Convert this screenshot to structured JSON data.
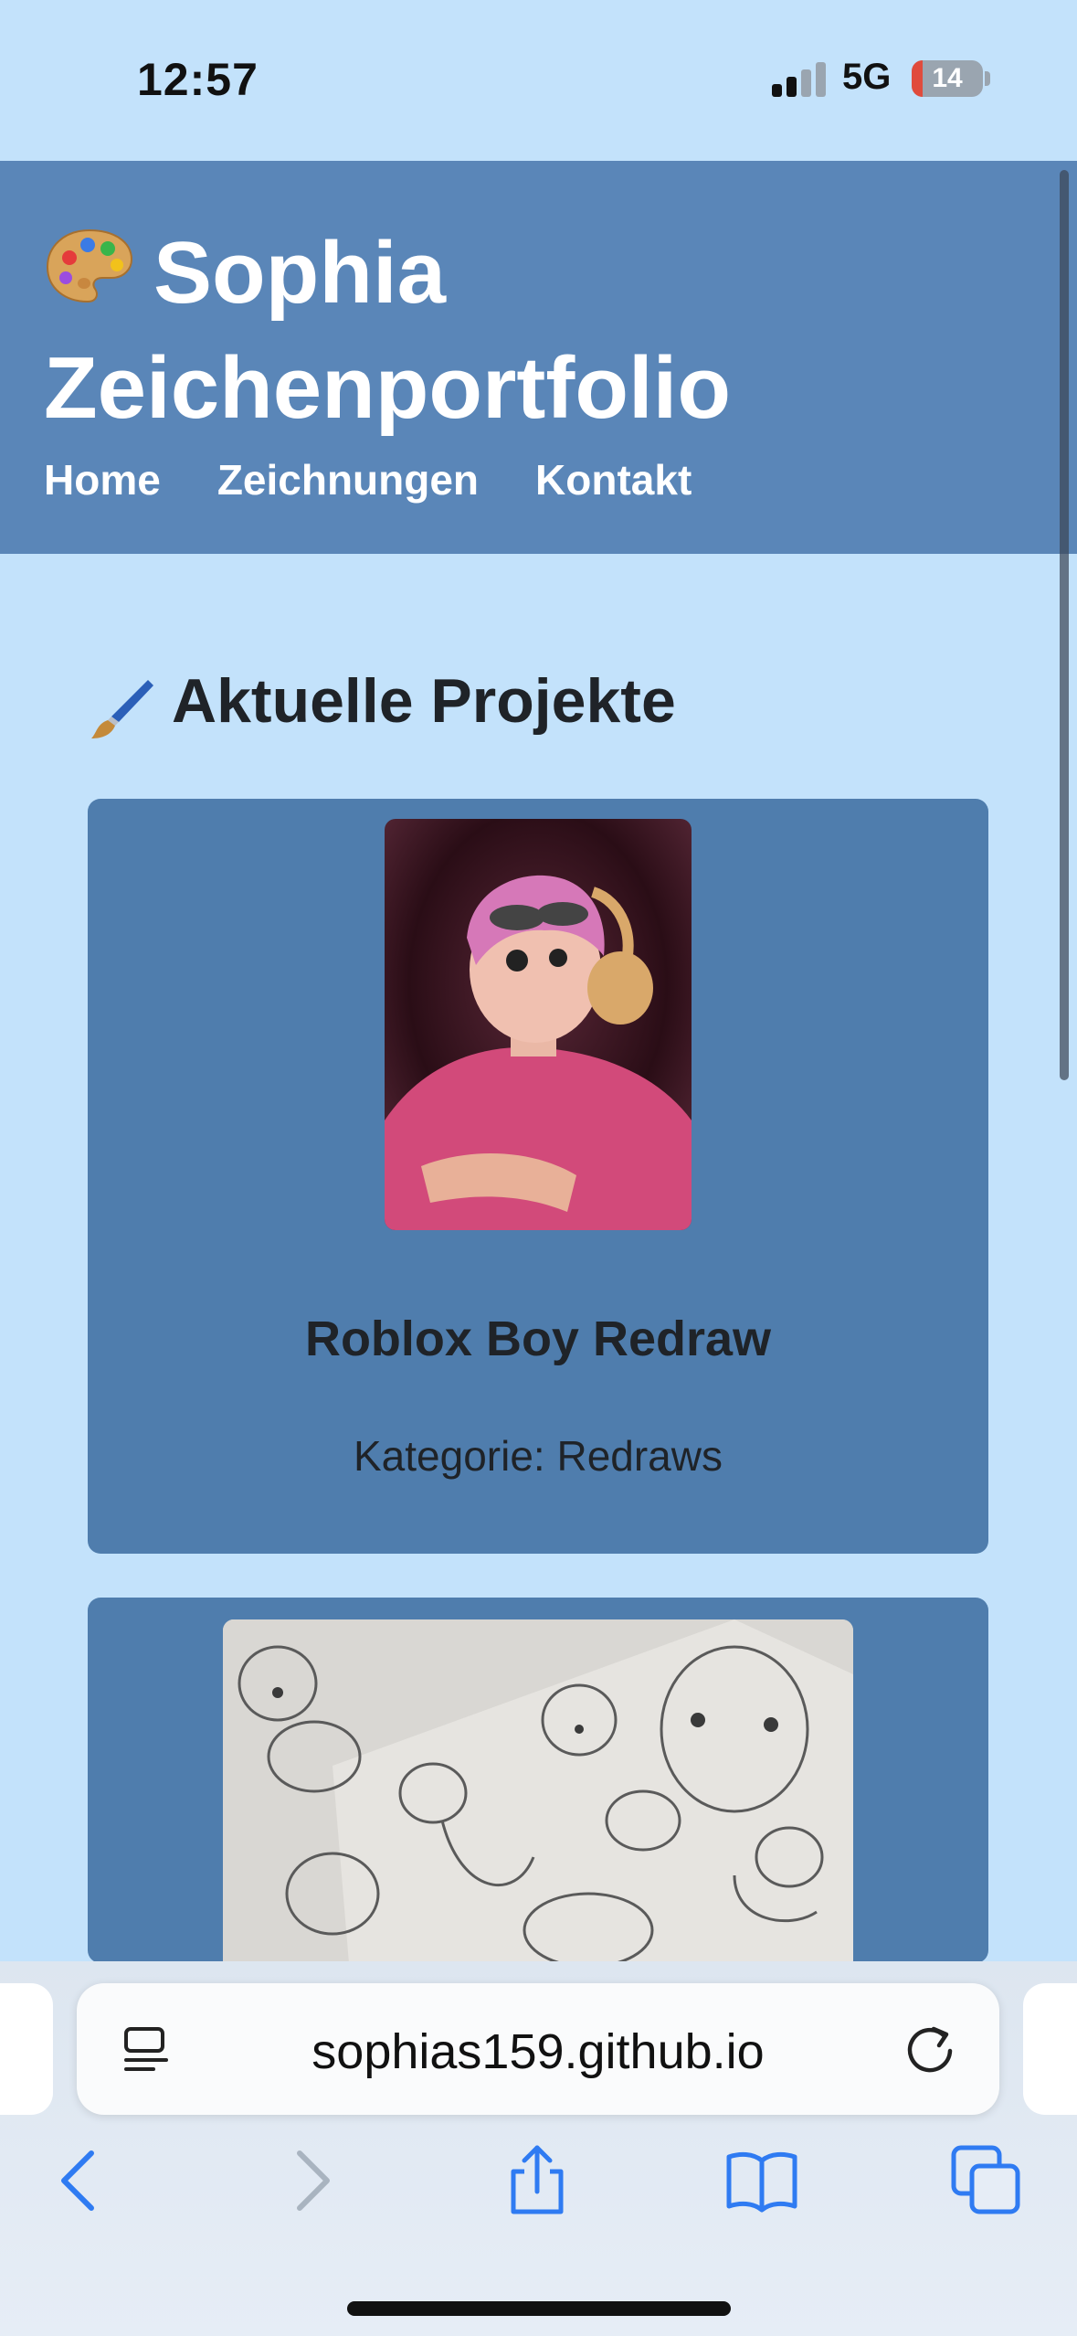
{
  "status_bar": {
    "time": "12:57",
    "network": "5G",
    "battery": "14"
  },
  "header": {
    "title_line1": "Sophia",
    "title_line2": "Zeichenportfolio",
    "nav": [
      "Home",
      "Zeichnungen",
      "Kontakt"
    ]
  },
  "main": {
    "section_title": "Aktuelle Projekte",
    "projects": [
      {
        "title": "Roblox Boy Redraw",
        "category": "Kategorie: Redraws"
      }
    ]
  },
  "browser": {
    "url": "sophias159.github.io"
  },
  "icons": [
    "palette-icon",
    "paintbrush-icon",
    "reader-icon",
    "reload-icon",
    "back-icon",
    "forward-icon",
    "share-icon",
    "bookmarks-icon",
    "tabs-icon"
  ],
  "colors": {
    "page_bg": "#c3e2fb",
    "header_bg": "#5a86b8",
    "card_bg": "#4f7dad",
    "toolbar_accent": "#2f7bf2"
  }
}
